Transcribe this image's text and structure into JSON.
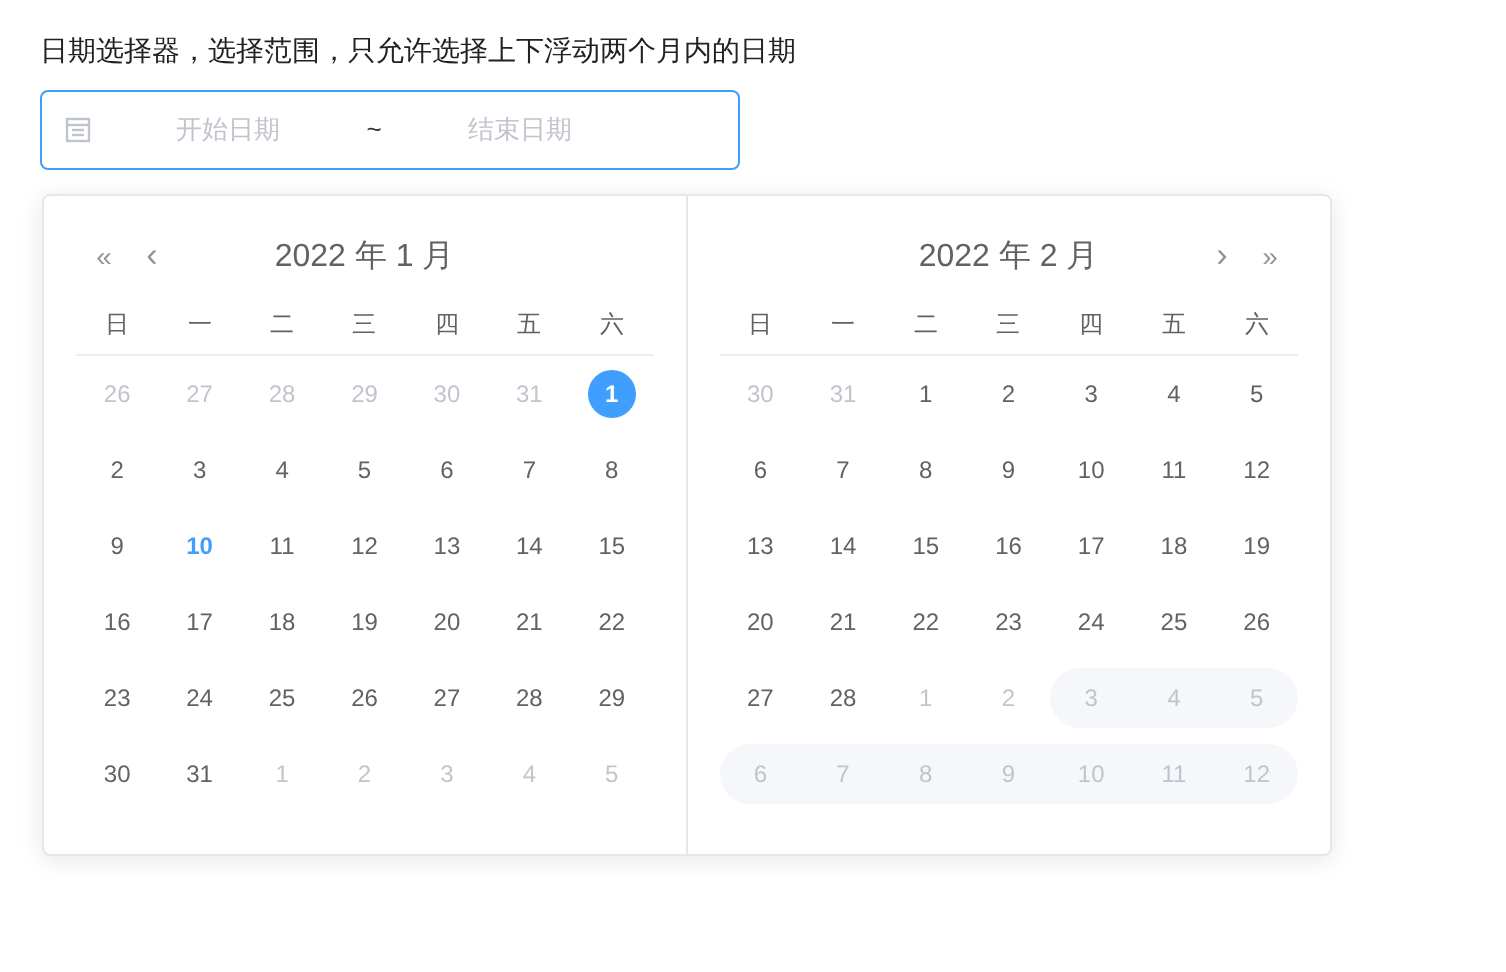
{
  "heading": "日期选择器，选择范围，只允许选择上下浮动两个月内的日期",
  "range_input": {
    "start_placeholder": "开始日期",
    "separator": "~",
    "end_placeholder": "结束日期",
    "focused": true
  },
  "panels": [
    {
      "title": "2022 年 1 月",
      "nav": [
        {
          "kind": "prev-year",
          "label": "«"
        },
        {
          "kind": "prev-month",
          "label": "‹"
        }
      ],
      "weekdays": [
        "日",
        "一",
        "二",
        "三",
        "四",
        "五",
        "六"
      ],
      "days": [
        {
          "label": "26",
          "kind": "other"
        },
        {
          "label": "27",
          "kind": "other"
        },
        {
          "label": "28",
          "kind": "other"
        },
        {
          "label": "29",
          "kind": "other"
        },
        {
          "label": "30",
          "kind": "other"
        },
        {
          "label": "31",
          "kind": "other"
        },
        {
          "label": "1",
          "kind": "selected"
        },
        {
          "label": "2",
          "kind": "current"
        },
        {
          "label": "3",
          "kind": "current"
        },
        {
          "label": "4",
          "kind": "current"
        },
        {
          "label": "5",
          "kind": "current"
        },
        {
          "label": "6",
          "kind": "current"
        },
        {
          "label": "7",
          "kind": "current"
        },
        {
          "label": "8",
          "kind": "current"
        },
        {
          "label": "9",
          "kind": "current"
        },
        {
          "label": "10",
          "kind": "today"
        },
        {
          "label": "11",
          "kind": "current"
        },
        {
          "label": "12",
          "kind": "current"
        },
        {
          "label": "13",
          "kind": "current"
        },
        {
          "label": "14",
          "kind": "current"
        },
        {
          "label": "15",
          "kind": "current"
        },
        {
          "label": "16",
          "kind": "current"
        },
        {
          "label": "17",
          "kind": "current"
        },
        {
          "label": "18",
          "kind": "current"
        },
        {
          "label": "19",
          "kind": "current"
        },
        {
          "label": "20",
          "kind": "current"
        },
        {
          "label": "21",
          "kind": "current"
        },
        {
          "label": "22",
          "kind": "current"
        },
        {
          "label": "23",
          "kind": "current"
        },
        {
          "label": "24",
          "kind": "current"
        },
        {
          "label": "25",
          "kind": "current"
        },
        {
          "label": "26",
          "kind": "current"
        },
        {
          "label": "27",
          "kind": "current"
        },
        {
          "label": "28",
          "kind": "current"
        },
        {
          "label": "29",
          "kind": "current"
        },
        {
          "label": "30",
          "kind": "current"
        },
        {
          "label": "31",
          "kind": "current"
        },
        {
          "label": "1",
          "kind": "other"
        },
        {
          "label": "2",
          "kind": "other"
        },
        {
          "label": "3",
          "kind": "other"
        },
        {
          "label": "4",
          "kind": "other"
        },
        {
          "label": "5",
          "kind": "other"
        }
      ]
    },
    {
      "title": "2022 年 2 月",
      "nav": [
        {
          "kind": "next-month",
          "label": "›"
        },
        {
          "kind": "next-year",
          "label": "»"
        }
      ],
      "weekdays": [
        "日",
        "一",
        "二",
        "三",
        "四",
        "五",
        "六"
      ],
      "days": [
        {
          "label": "30",
          "kind": "other"
        },
        {
          "label": "31",
          "kind": "other"
        },
        {
          "label": "1",
          "kind": "current"
        },
        {
          "label": "2",
          "kind": "current"
        },
        {
          "label": "3",
          "kind": "current"
        },
        {
          "label": "4",
          "kind": "current"
        },
        {
          "label": "5",
          "kind": "current"
        },
        {
          "label": "6",
          "kind": "current"
        },
        {
          "label": "7",
          "kind": "current"
        },
        {
          "label": "8",
          "kind": "current"
        },
        {
          "label": "9",
          "kind": "current"
        },
        {
          "label": "10",
          "kind": "current"
        },
        {
          "label": "11",
          "kind": "current"
        },
        {
          "label": "12",
          "kind": "current"
        },
        {
          "label": "13",
          "kind": "current"
        },
        {
          "label": "14",
          "kind": "current"
        },
        {
          "label": "15",
          "kind": "current"
        },
        {
          "label": "16",
          "kind": "current"
        },
        {
          "label": "17",
          "kind": "current"
        },
        {
          "label": "18",
          "kind": "current"
        },
        {
          "label": "19",
          "kind": "current"
        },
        {
          "label": "20",
          "kind": "current"
        },
        {
          "label": "21",
          "kind": "current"
        },
        {
          "label": "22",
          "kind": "current"
        },
        {
          "label": "23",
          "kind": "current"
        },
        {
          "label": "24",
          "kind": "current"
        },
        {
          "label": "25",
          "kind": "current"
        },
        {
          "label": "26",
          "kind": "current"
        },
        {
          "label": "27",
          "kind": "current"
        },
        {
          "label": "28",
          "kind": "current"
        },
        {
          "label": "1",
          "kind": "other"
        },
        {
          "label": "2",
          "kind": "other"
        },
        {
          "label": "3",
          "kind": "disabled"
        },
        {
          "label": "4",
          "kind": "disabled"
        },
        {
          "label": "5",
          "kind": "disabled"
        },
        {
          "label": "6",
          "kind": "disabled"
        },
        {
          "label": "7",
          "kind": "disabled"
        },
        {
          "label": "8",
          "kind": "disabled"
        },
        {
          "label": "9",
          "kind": "disabled"
        },
        {
          "label": "10",
          "kind": "disabled"
        },
        {
          "label": "11",
          "kind": "disabled"
        },
        {
          "label": "12",
          "kind": "disabled"
        }
      ]
    }
  ]
}
